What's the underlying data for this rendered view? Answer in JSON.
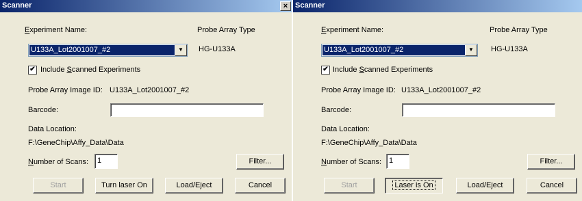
{
  "left": {
    "title": "Scanner",
    "close_glyph": "×",
    "experiment_name_label_underlined": "E",
    "experiment_name_label_rest": "xperiment Name:",
    "experiment_name_value": "U133A_Lot2001007_#2",
    "probe_array_type_label": "Probe Array Type",
    "probe_array_type_value": "HG-U133A",
    "check_mark": "✔",
    "include_label_pre": "Include ",
    "include_label_underlined": "S",
    "include_label_post": "canned Experiments",
    "probe_array_image_id_label": "Probe Array Image ID:",
    "probe_array_image_id_value": "U133A_Lot2001007_#2",
    "barcode_label": "Barcode:",
    "barcode_value": "",
    "data_location_label": "Data Location:",
    "data_location_value": "F:\\GeneChip\\Affy_Data\\Data",
    "num_scans_label_underlined": "N",
    "num_scans_label_rest": "umber of Scans:",
    "num_scans_value": "1",
    "filter_button": "Filter...",
    "start_button": "Start",
    "laser_button": "Turn laser On",
    "load_eject_button": "Load/Eject",
    "cancel_button": "Cancel"
  },
  "right": {
    "title": "Scanner",
    "experiment_name_label_underlined": "E",
    "experiment_name_label_rest": "xperiment Name:",
    "experiment_name_value": "U133A_Lot2001007_#2",
    "probe_array_type_label": "Probe Array Type",
    "probe_array_type_value": "HG-U133A",
    "check_mark": "✔",
    "include_label_pre": "Include ",
    "include_label_underlined": "S",
    "include_label_post": "canned Experiments",
    "probe_array_image_id_label": "Probe Array Image ID:",
    "probe_array_image_id_value": "U133A_Lot2001007_#2",
    "barcode_label": "Barcode:",
    "barcode_value": "",
    "data_location_label": "Data Location:",
    "data_location_value": "F:\\GeneChip\\Affy_Data\\Data",
    "num_scans_label_underlined": "N",
    "num_scans_label_rest": "umber of Scans:",
    "num_scans_value": "1",
    "filter_button": "Filter...",
    "start_button": "Start",
    "laser_button": "Laser is On",
    "load_eject_button": "Load/Eject",
    "cancel_button": "Cancel"
  },
  "combo_arrow": "▼"
}
